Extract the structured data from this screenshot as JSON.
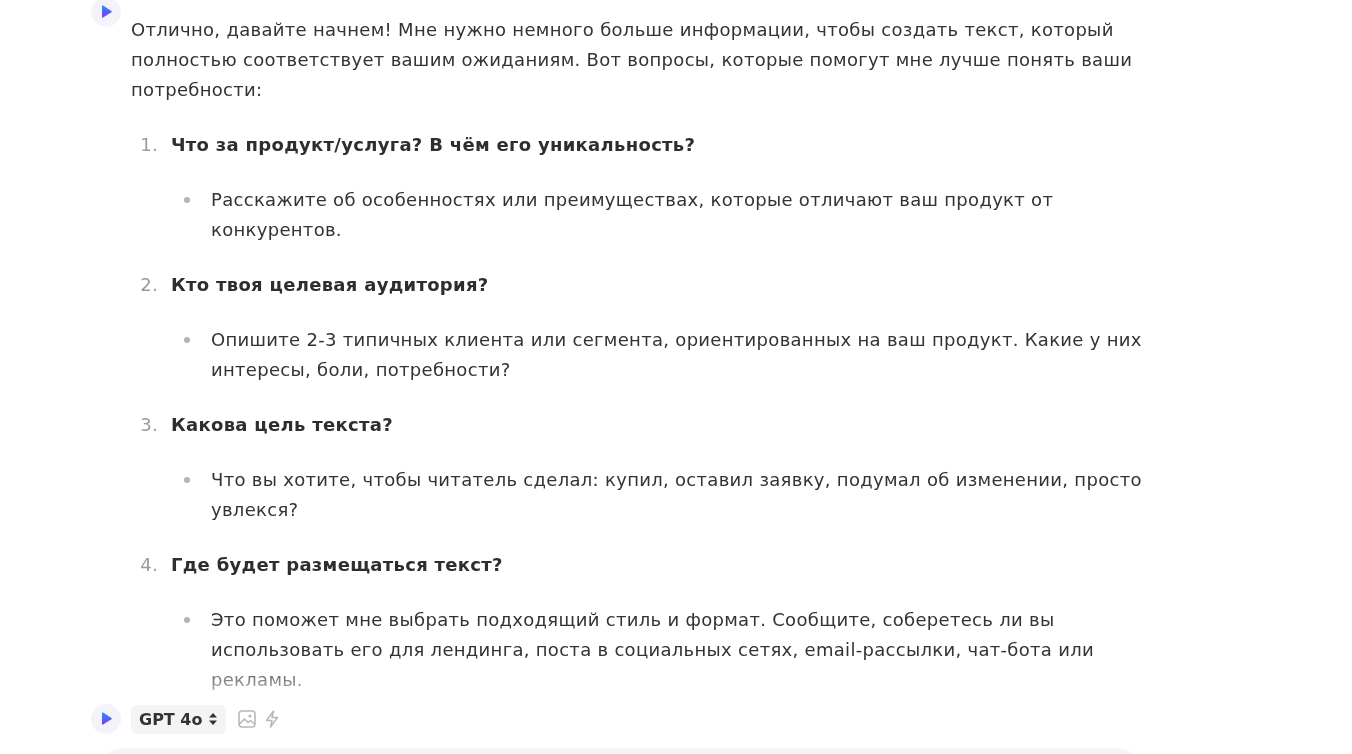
{
  "assistant_message": {
    "intro": "Отлично, давайте начнем! Мне нужно немного больше информации, чтобы создать текст, который полностью соответствует вашим ожиданиям. Вот вопросы, которые помогут мне лучше понять ваши потребности:",
    "questions": [
      {
        "number": "1.",
        "title": "Что за продукт/услуга? В чём его уникальность?",
        "details": [
          "Расскажите об особенностях или преимуществах, которые отличают ваш продукт от конкурентов."
        ]
      },
      {
        "number": "2.",
        "title": "Кто твоя целевая аудитория?",
        "details": [
          "Опишите 2-3 типичных клиента или сегмента, ориентированных на ваш продукт. Какие у них интересы, боли, потребности?"
        ]
      },
      {
        "number": "3.",
        "title": "Какова цель текста?",
        "details": [
          "Что вы хотите, чтобы читатель сделал: купил, оставил заявку, подумал об изменении, просто увлекся?"
        ]
      },
      {
        "number": "4.",
        "title": "Где будет размещаться текст?",
        "details": [
          "Это поможет мне выбрать подходящий стиль и формат. Сообщите, соберетесь ли вы использовать его для лендинга, поста в социальных сетях, email-рассылки, чат-бота или рекламы."
        ]
      }
    ]
  },
  "composer": {
    "model": "GPT 4o"
  }
}
